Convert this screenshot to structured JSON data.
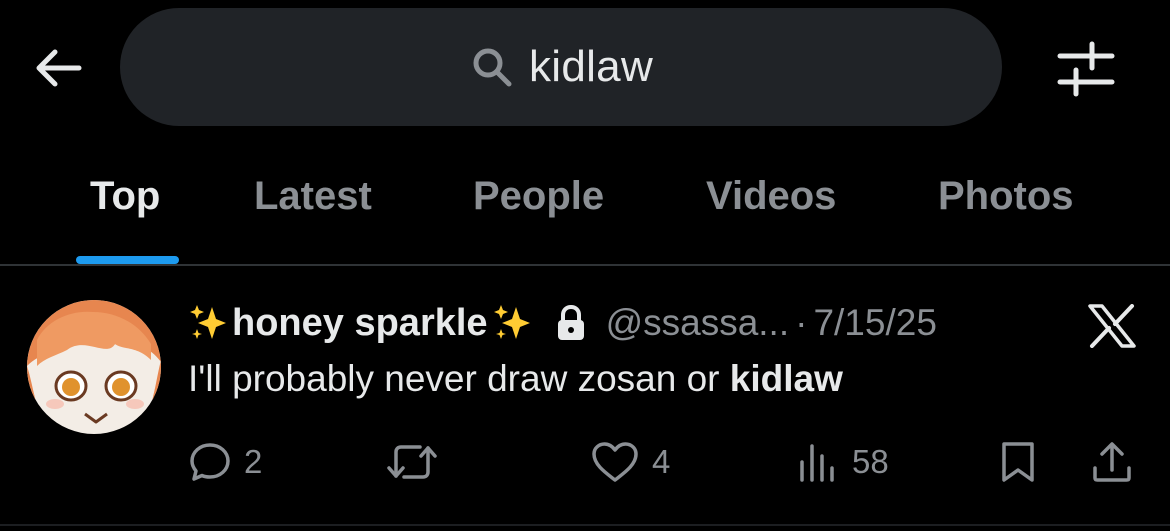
{
  "header": {
    "search_query": "kidlaw"
  },
  "tabs": [
    {
      "label": "Top",
      "active": true
    },
    {
      "label": "Latest",
      "active": false
    },
    {
      "label": "People",
      "active": false
    },
    {
      "label": "Videos",
      "active": false
    },
    {
      "label": "Photos",
      "active": false
    }
  ],
  "post": {
    "display_name": "honey sparkle",
    "name_decoration": "sparkles-icon",
    "locked": true,
    "handle": "@ssassa...",
    "separator": "·",
    "date": "7/15/25",
    "text_before": "I'll probably never draw zosan or ",
    "text_highlight": "kidlaw",
    "actions": {
      "replies": "2",
      "reposts": "",
      "likes": "4",
      "views": "58"
    }
  },
  "colors": {
    "background": "#000000",
    "search_pill": "#202327",
    "accent": "#1d9bf0",
    "muted_text": "#8b8f94",
    "primary_text": "#e7e9ea"
  }
}
